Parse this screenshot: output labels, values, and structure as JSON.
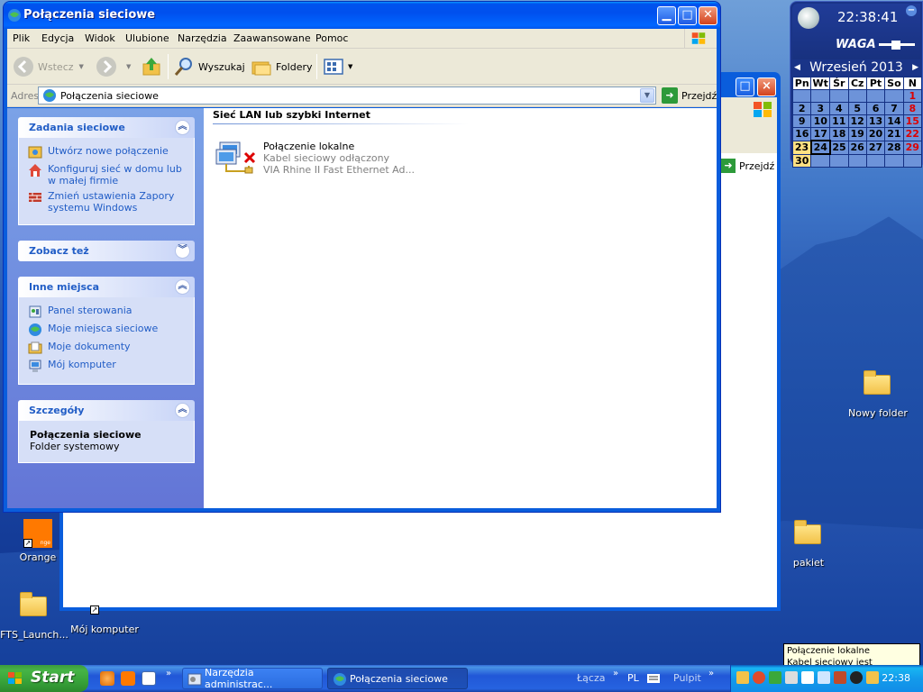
{
  "window": {
    "title": "Połączenia sieciowe",
    "menu": [
      "Plik",
      "Edycja",
      "Widok",
      "Ulubione",
      "Narzędzia",
      "Zaawansowane",
      "Pomoc"
    ],
    "toolbar": {
      "back": "Wstecz",
      "search": "Wyszukaj",
      "folders": "Foldery"
    },
    "address": {
      "label": "Adres",
      "value": "Połączenia sieciowe",
      "go": "Przejdź"
    }
  },
  "left_pane": {
    "network_tasks": {
      "title": "Zadania sieciowe",
      "links": [
        "Utwórz nowe połączenie",
        "Konfiguruj sieć w domu lub w małej firmie",
        "Zmień ustawienia Zapory systemu Windows"
      ]
    },
    "see_also": {
      "title": "Zobacz też"
    },
    "other_places": {
      "title": "Inne miejsca",
      "links": [
        "Panel sterowania",
        "Moje miejsca sieciowe",
        "Moje dokumenty",
        "Mój komputer"
      ]
    },
    "details": {
      "title": "Szczegóły",
      "name": "Połączenia sieciowe",
      "type": "Folder systemowy"
    }
  },
  "content": {
    "group_header": "Sieć LAN lub szybki Internet",
    "connection": {
      "name": "Połączenie lokalne",
      "status": "Kabel sieciowy odłączony",
      "device": "VIA Rhine II Fast Ethernet Ad..."
    }
  },
  "background_window": {
    "go": "Przejdź"
  },
  "widget": {
    "time": "22:38:41",
    "brand": "WAGA",
    "month": "Wrzesień 2013",
    "weekdays": [
      "Pn",
      "Wt",
      "Śr",
      "Cz",
      "Pt",
      "So",
      "N"
    ],
    "weeks": [
      [
        "",
        "",
        "",
        "",
        "",
        "",
        "1"
      ],
      [
        "2",
        "3",
        "4",
        "5",
        "6",
        "7",
        "8"
      ],
      [
        "9",
        "10",
        "11",
        "12",
        "13",
        "14",
        "15"
      ],
      [
        "16",
        "17",
        "18",
        "19",
        "20",
        "21",
        "22"
      ],
      [
        "23",
        "24",
        "25",
        "26",
        "27",
        "28",
        "29"
      ],
      [
        "30",
        "",
        "",
        "",
        "",
        "",
        ""
      ]
    ],
    "today": "24"
  },
  "desktop_icons": {
    "orange": "Orange",
    "fts": "FTS_Launch...",
    "my_computer": "Mój komputer",
    "new_folder": "Nowy folder",
    "pakiet": "pakiet"
  },
  "tooltip": {
    "line1": "Połączenie lokalne",
    "line2": "Kabel sieciowy jest odłączony."
  },
  "taskbar": {
    "start": "Start",
    "tasks": [
      "Narzędzia administrac...",
      "Połączenia sieciowe"
    ],
    "links_label": "Łącza",
    "language": "PL",
    "desktop_label": "Pulpit",
    "clock": "22:38"
  },
  "colors": {
    "xp_blue": "#0a5ddc",
    "task_link": "#215dc6",
    "taskbar": "#2157d7",
    "start_green": "#38a33a",
    "sunday_red": "#dd0000"
  }
}
